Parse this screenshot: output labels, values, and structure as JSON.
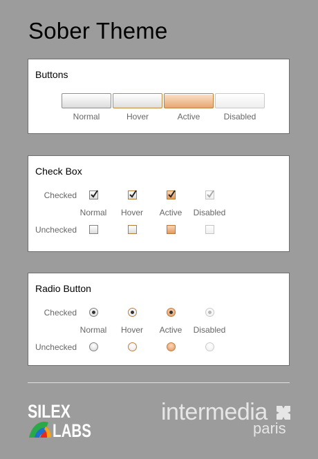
{
  "title": "Sober Theme",
  "buttons": {
    "heading": "Buttons",
    "states": [
      "Normal",
      "Hover",
      "Active",
      "Disabled"
    ]
  },
  "checkbox": {
    "heading": "Check Box",
    "row_checked": "Checked",
    "row_unchecked": "Unchecked",
    "states": [
      "Normal",
      "Hover",
      "Active",
      "Disabled"
    ]
  },
  "radio": {
    "heading": "Radio Button",
    "row_checked": "Checked",
    "row_unchecked": "Unchecked",
    "states": [
      "Normal",
      "Hover",
      "Active",
      "Disabled"
    ]
  },
  "footer": {
    "silex_line1": "SILEX",
    "silex_line2": "LABS",
    "intermedia": "intermedia",
    "paris": "paris"
  },
  "colors": {
    "background": "#9c9c9c",
    "accent_border": "#c0803e",
    "active_fill": "#e8a672"
  }
}
